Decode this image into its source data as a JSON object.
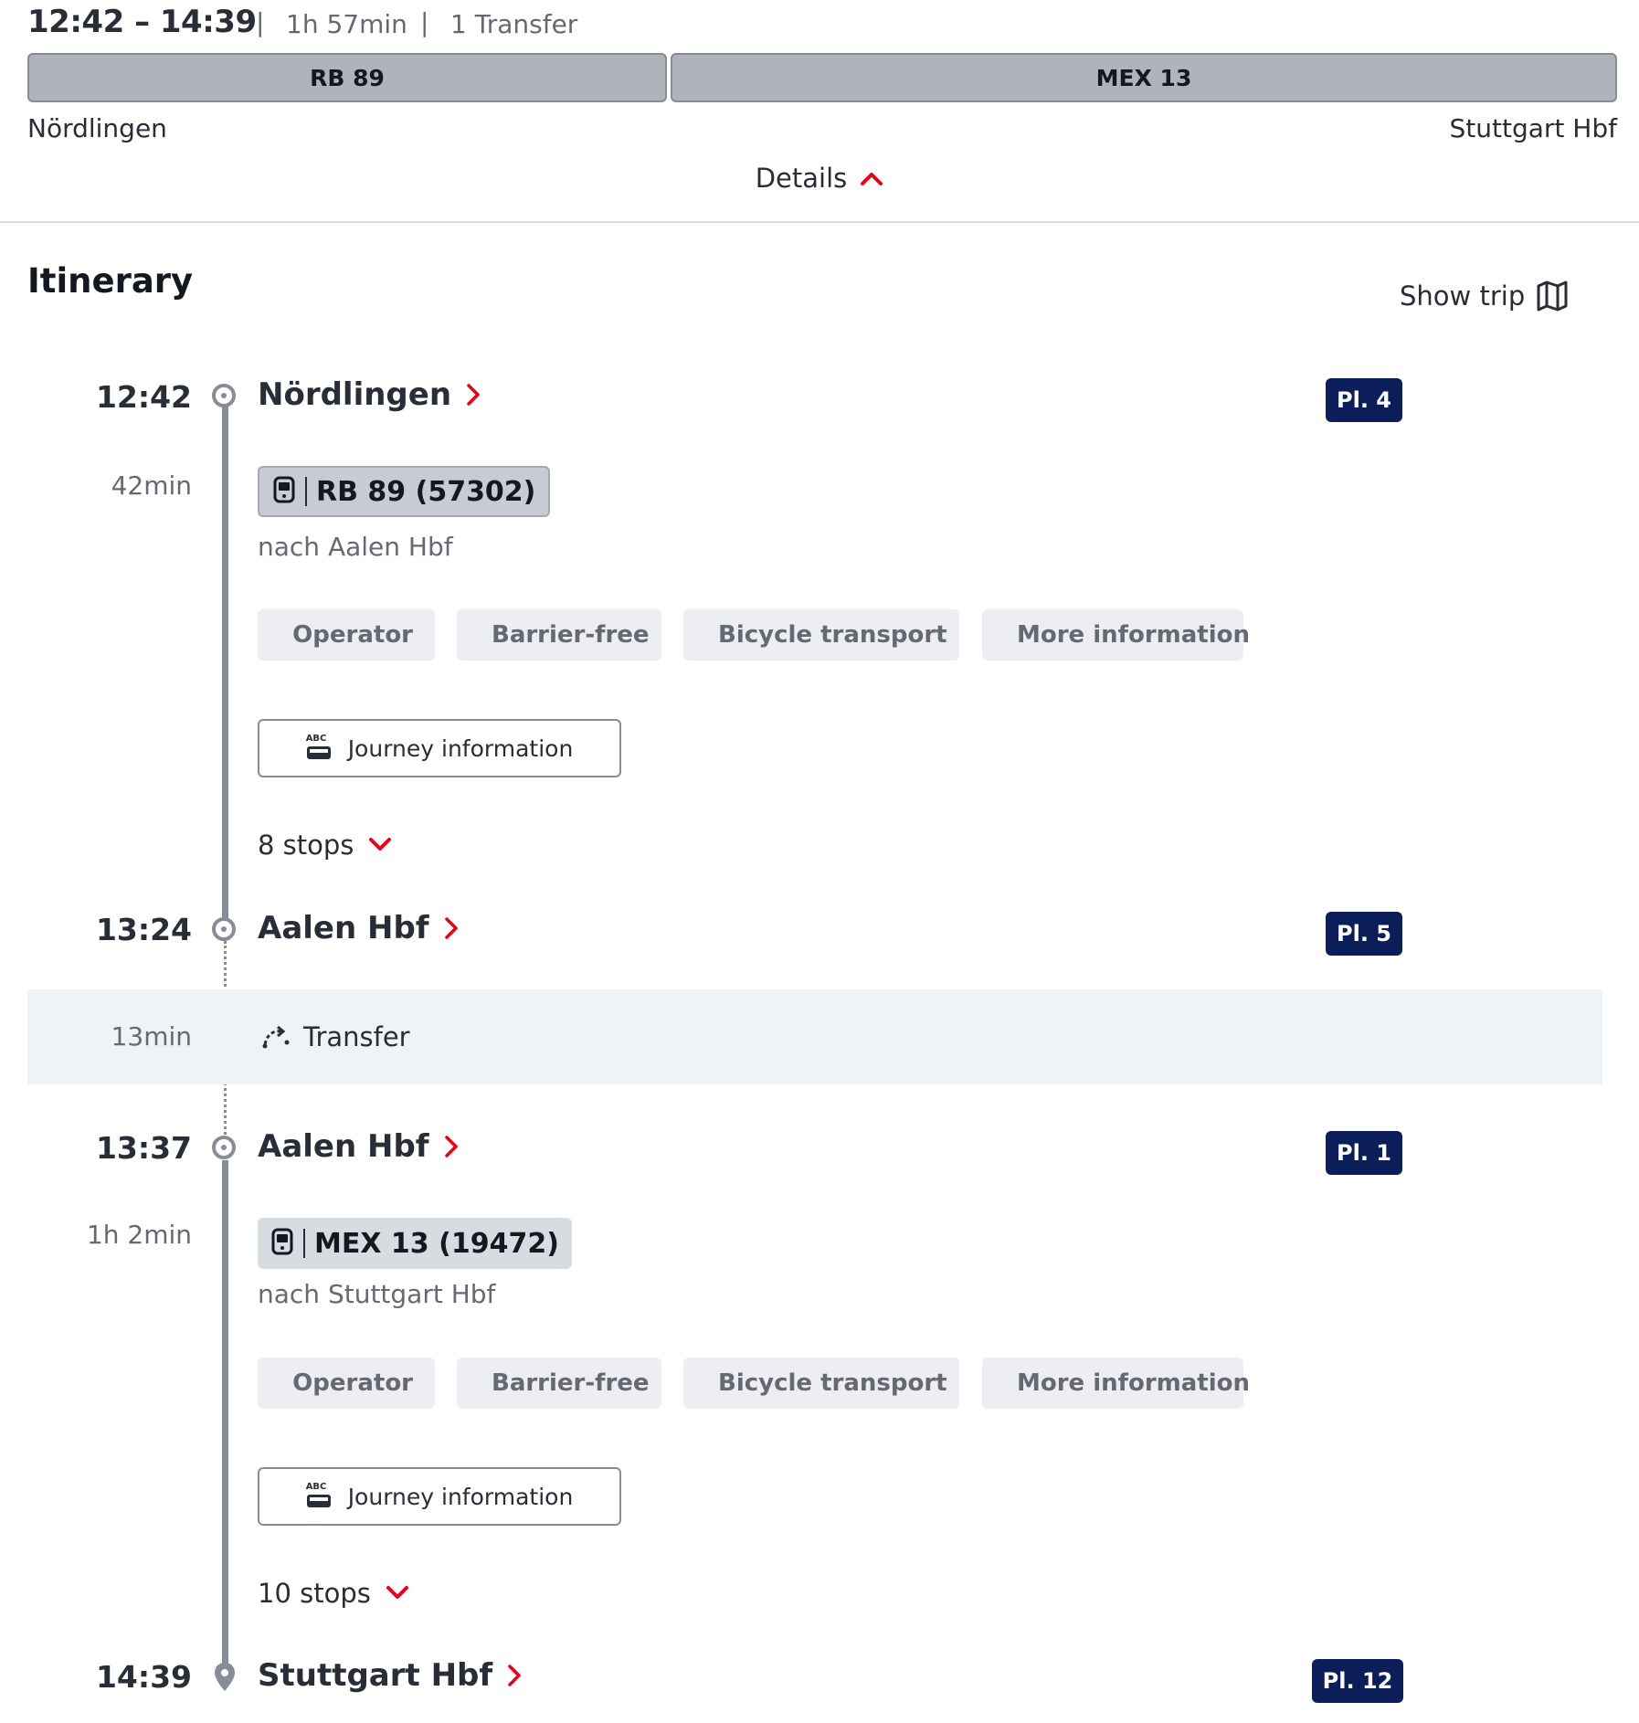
{
  "summary": {
    "time_range": "12:42 – 14:39",
    "duration": "1h 57min",
    "transfers": "1 Transfer",
    "separator": "|",
    "segments": [
      {
        "label": "RB 89"
      },
      {
        "label": "MEX 13"
      }
    ],
    "origin": "Nördlingen",
    "destination": "Stuttgart Hbf",
    "details_label": "Details"
  },
  "itinerary": {
    "title": "Itinerary",
    "show_trip_label": "Show trip",
    "stops": [
      {
        "time": "12:42",
        "name": "Nördlingen",
        "platform": "Pl. 4"
      },
      {
        "time": "13:24",
        "name": "Aalen Hbf",
        "platform": "Pl. 5"
      },
      {
        "time": "13:37",
        "name": "Aalen Hbf",
        "platform": "Pl. 1"
      },
      {
        "time": "14:39",
        "name": "Stuttgart Hbf",
        "platform": "Pl. 12"
      }
    ],
    "legs": [
      {
        "duration": "42min",
        "train": "RB 89 (57302)",
        "direction": "nach Aalen Hbf",
        "stops_label": "8 stops"
      },
      {
        "duration": "1h 2min",
        "train": "MEX 13 (19472)",
        "direction": "nach Stuttgart Hbf",
        "stops_label": "10 stops"
      }
    ],
    "chips": {
      "operator": "Operator",
      "barrier_free": "Barrier-free",
      "bicycle": "Bicycle transport",
      "more_info": "More information"
    },
    "journey_info_label": "Journey information",
    "journey_icon_text": "ABC",
    "transfer": {
      "duration": "13min",
      "label": "Transfer"
    }
  },
  "colors": {
    "accent_red": "#ec0016",
    "platform_bg": "#0c1e5a",
    "line_grey": "#878c96"
  },
  "icons": [
    "chevron-up-icon",
    "map-icon",
    "chevron-right-icon",
    "train-icon",
    "bus-icon",
    "wheelchair-icon",
    "bicycle-icon",
    "info-icon",
    "journey-info-icon",
    "chevron-down-icon",
    "transfer-icon",
    "location-pin-icon"
  ]
}
